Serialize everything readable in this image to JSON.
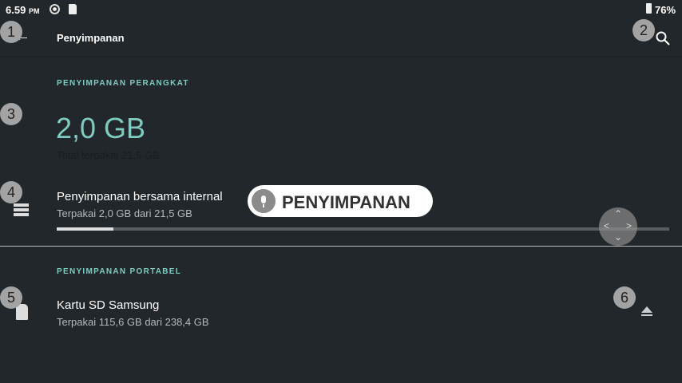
{
  "status": {
    "time": "6.59",
    "ampm": "PM",
    "battery": "76%"
  },
  "header": {
    "title": "Penyimpanan"
  },
  "device": {
    "section": "PENYIMPANAN PERANGKAT",
    "used": "2,0 GB",
    "total": "Total terpakai 21,5 GB"
  },
  "internal": {
    "title": "Penyimpanan bersama internal",
    "summary": "Terpakai 2,0 GB dari 21,5 GB",
    "progress": 0.093
  },
  "portable": {
    "section": "PENYIMPANAN PORTABEL",
    "title": "Kartu SD Samsung",
    "summary": "Terpakai 115,6 GB dari 238,4 GB"
  },
  "voice": {
    "label": "PENYIMPANAN"
  },
  "badges": [
    "1",
    "2",
    "3",
    "4",
    "5",
    "6"
  ],
  "colors": {
    "accent": "#7fcbc0",
    "background": "#22272b"
  }
}
